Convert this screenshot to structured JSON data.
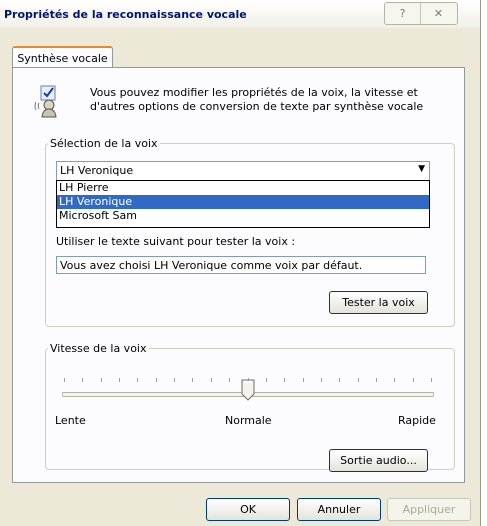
{
  "window": {
    "title": "Propriétés de la reconnaissance vocale",
    "help_label": "?",
    "close_label": "✕"
  },
  "tabs": [
    {
      "label": "Synthèse vocale",
      "active": true
    }
  ],
  "intro": {
    "text": "Vous pouvez modifier les propriétés de la voix, la vitesse et d'autres options de conversion de texte par synthèse vocale",
    "icon": "speech-properties-icon"
  },
  "voice_selection": {
    "legend": "Sélection de la voix",
    "selected": "LH Veronique",
    "options": [
      "LH Pierre",
      "LH Veronique",
      "Microsoft Sam"
    ],
    "test_label": "Utiliser le texte suivant pour tester la voix :",
    "test_text": "Vous avez choisi LH Veronique comme voix par défaut.",
    "test_button": "Tester la voix"
  },
  "voice_speed": {
    "legend": "Vitesse de la voix",
    "value_fraction": 0.5,
    "label_slow": "Lente",
    "label_normal": "Normale",
    "label_fast": "Rapide",
    "audio_button": "Sortie audio..."
  },
  "footer": {
    "ok": "OK",
    "cancel": "Annuler",
    "apply": "Appliquer"
  },
  "colors": {
    "title_text": "#00156e",
    "selection": "#316ac5",
    "tab_accent": "#e68b2c"
  }
}
